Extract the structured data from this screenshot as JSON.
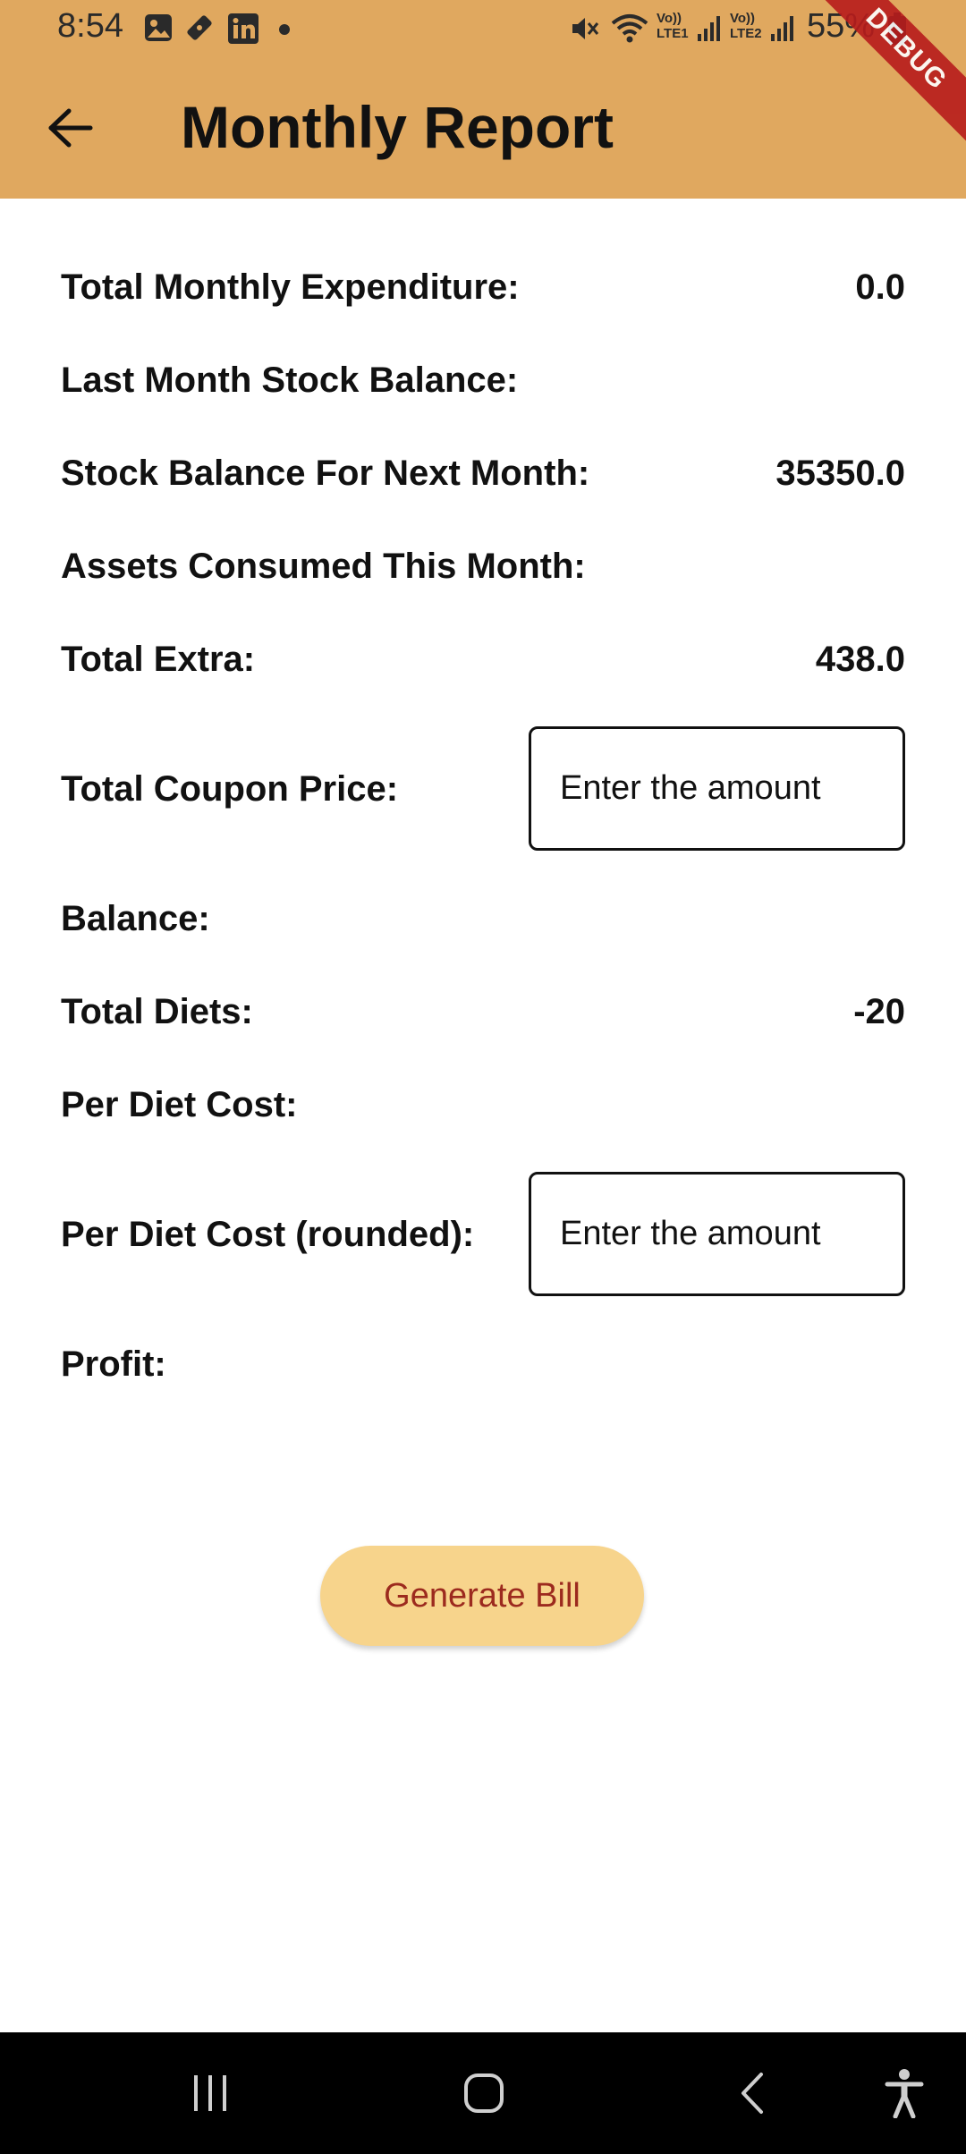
{
  "status_bar": {
    "time": "8:54",
    "battery": "55%",
    "network_labels": [
      "Vo)) LTE1",
      "Vo)) LTE2"
    ],
    "icons": [
      "image-icon",
      "ticket-icon",
      "linkedin-icon",
      "dot-icon",
      "mute-icon",
      "wifi-icon",
      "signal-icon",
      "signal-icon",
      "battery-icon"
    ]
  },
  "app_bar": {
    "title": "Monthly Report",
    "back_icon": "arrow-left-icon",
    "background_color": "#E0A85F",
    "debug_banner": "DEBUG"
  },
  "report": {
    "total_monthly_expenditure": {
      "label": "Total Monthly Expenditure:",
      "value": "0.0"
    },
    "last_month_stock_balance": {
      "label": "Last Month Stock Balance:",
      "value": ""
    },
    "stock_balance_next_month": {
      "label": "Stock Balance For Next Month:",
      "value": "35350.0"
    },
    "assets_consumed": {
      "label": "Assets Consumed This Month:",
      "value": ""
    },
    "total_extra": {
      "label": "Total Extra:",
      "value": "438.0"
    },
    "total_coupon_price": {
      "label": "Total Coupon Price:",
      "placeholder": "Enter the amount",
      "value": ""
    },
    "balance": {
      "label": "Balance:",
      "value": ""
    },
    "total_diets": {
      "label": "Total Diets:",
      "value": "-20"
    },
    "per_diet_cost": {
      "label": "Per Diet Cost:",
      "value": ""
    },
    "per_diet_cost_rounded": {
      "label": "Per Diet Cost (rounded):",
      "placeholder": "Enter the amount",
      "value": ""
    },
    "profit": {
      "label": "Profit:",
      "value": ""
    }
  },
  "actions": {
    "generate_bill_label": "Generate Bill",
    "button_color": "#F7D48C",
    "button_text_color": "#9C2A1E"
  },
  "nav_bar": {
    "items": [
      "recent-apps-icon",
      "home-icon",
      "back-icon",
      "accessibility-icon"
    ]
  }
}
